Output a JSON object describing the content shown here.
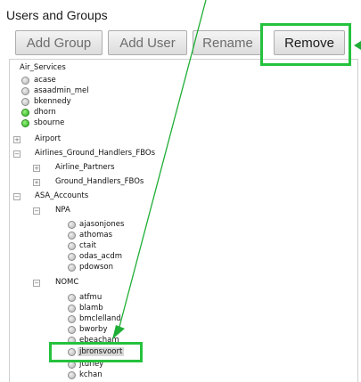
{
  "panel": {
    "title": "Users and Groups"
  },
  "toolbar": {
    "add_group": "Add Group",
    "add_user": "Add User",
    "rename": "Rename",
    "remove": "Remove"
  },
  "tree": {
    "air_services": {
      "label": "Air_Services",
      "users": [
        {
          "label": "acase",
          "online": false
        },
        {
          "label": "asaadmin_mel",
          "online": false
        },
        {
          "label": "bkennedy",
          "online": false
        },
        {
          "label": "dhorn",
          "online": true
        },
        {
          "label": "sbourne",
          "online": true
        }
      ]
    },
    "airport": {
      "label": "Airport"
    },
    "airlines": {
      "label": "Airlines_Ground_Handlers_FBOs",
      "airline_partners": "Airline_Partners",
      "ground_handlers": "Ground_Handlers_FBOs"
    },
    "asa_accounts": {
      "label": "ASA_Accounts",
      "npa": {
        "label": "NPA",
        "users": [
          "ajasonjones",
          "athomas",
          "ctait",
          "odas_acdm",
          "pdowson"
        ]
      },
      "nomc": {
        "label": "NOMC",
        "users": [
          "atfmu",
          "blamb",
          "bmclelland",
          "bworby",
          "ebeacham",
          "jbronsvoort",
          "jturley",
          "kchan"
        ]
      }
    }
  },
  "colors": {
    "highlight": "#25c23d",
    "online": "#27b11a",
    "offline": "#b4b4b4"
  }
}
